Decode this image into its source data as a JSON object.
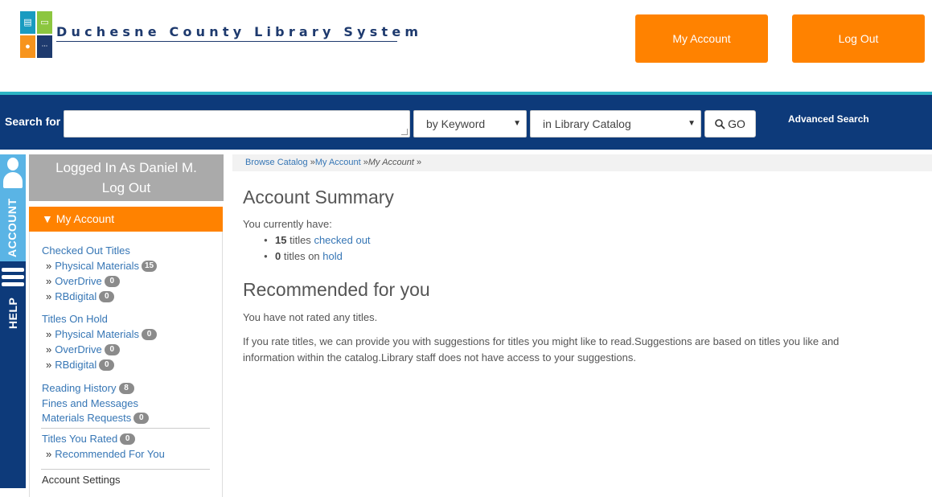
{
  "header": {
    "site_name": "Duchesne County Library System",
    "my_account_label": "My Account",
    "logout_label": "Log Out"
  },
  "search": {
    "label": "Search for",
    "query_value": "",
    "type_selected": "by Keyword",
    "scope_selected": "in Library Catalog",
    "go_label": "GO",
    "advanced_label": "Advanced Search"
  },
  "tabs": {
    "account": "ACCOUNT",
    "help": "HELP"
  },
  "sidebar": {
    "logged_in_as": "Logged In As Daniel M.",
    "logout_link": "Log Out",
    "menu_title": "My Account",
    "checked_out": {
      "title": "Checked Out Titles",
      "items": [
        {
          "label": "Physical Materials",
          "count": "15"
        },
        {
          "label": "OverDrive",
          "count": "0"
        },
        {
          "label": "RBdigital",
          "count": "0"
        }
      ]
    },
    "on_hold": {
      "title": "Titles On Hold",
      "items": [
        {
          "label": "Physical Materials",
          "count": "0"
        },
        {
          "label": "OverDrive",
          "count": "0"
        },
        {
          "label": "RBdigital",
          "count": "0"
        }
      ]
    },
    "reading_history": {
      "label": "Reading History",
      "count": "8"
    },
    "fines": {
      "label": "Fines and Messages"
    },
    "materials_requests": {
      "label": "Materials Requests",
      "count": "0"
    },
    "titles_rated": {
      "label": "Titles You Rated",
      "count": "0"
    },
    "recommended": {
      "label": "Recommended For You"
    },
    "account_settings": {
      "label": "Account Settings"
    }
  },
  "breadcrumb": {
    "browse": "Browse Catalog",
    "account": "My Account",
    "current": "My Account",
    "sep": "»"
  },
  "main": {
    "summary_heading": "Account Summary",
    "currently_have": "You currently have:",
    "checked_count": "15",
    "checked_mid": " titles ",
    "checked_link": "checked out",
    "hold_count": "0",
    "hold_mid": " titles on ",
    "hold_link": "hold",
    "rec_heading": "Recommended for you",
    "not_rated": "You have not rated any titles.",
    "rate_info": "If you rate titles, we can provide you with suggestions for titles you might like to read.Suggestions are based on titles you like and information within the catalog.Library staff does not have access to your suggestions."
  }
}
